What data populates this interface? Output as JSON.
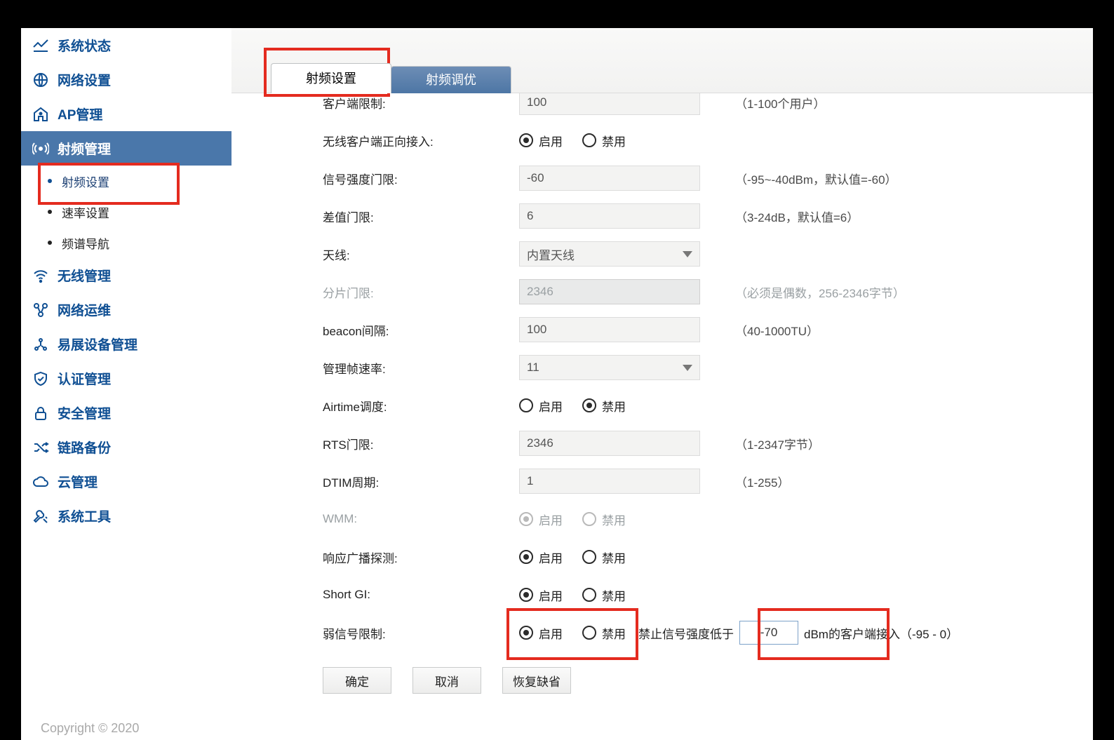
{
  "sidebar": {
    "items": [
      {
        "id": "system-status",
        "label": "系统状态"
      },
      {
        "id": "network-settings",
        "label": "网络设置"
      },
      {
        "id": "ap-management",
        "label": "AP管理"
      },
      {
        "id": "rf-management",
        "label": "射频管理"
      },
      {
        "id": "wireless-management",
        "label": "无线管理"
      },
      {
        "id": "network-ops",
        "label": "网络运维"
      },
      {
        "id": "yizhan-device",
        "label": "易展设备管理"
      },
      {
        "id": "auth-management",
        "label": "认证管理"
      },
      {
        "id": "security-management",
        "label": "安全管理"
      },
      {
        "id": "link-backup",
        "label": "链路备份"
      },
      {
        "id": "cloud-management",
        "label": "云管理"
      },
      {
        "id": "system-tools",
        "label": "系统工具"
      }
    ],
    "sub_items": [
      {
        "id": "rf-settings",
        "label": "射频设置"
      },
      {
        "id": "rate-settings",
        "label": "速率设置"
      },
      {
        "id": "spectrum-nav",
        "label": "频谱导航"
      }
    ],
    "active": "rf-management",
    "current_sub": "rf-settings"
  },
  "footer": {
    "copyright": "Copyright © 2020"
  },
  "tabs": {
    "items": [
      {
        "id": "rf-settings-tab",
        "label": "射频设置"
      },
      {
        "id": "rf-tuning-tab",
        "label": "射频调优"
      }
    ],
    "active": "rf-settings-tab"
  },
  "options": {
    "enable": "启用",
    "disable": "禁用"
  },
  "form": {
    "client_limit": {
      "label": "客户端限制:",
      "value": "100",
      "hint": "（1-100个用户）"
    },
    "positive_access": {
      "label": "无线客户端正向接入:",
      "value": "enable"
    },
    "signal_threshold": {
      "label": "信号强度门限:",
      "value": "-60",
      "hint": "（-95~-40dBm，默认值=-60）"
    },
    "diff_threshold": {
      "label": "差值门限:",
      "value": "6",
      "hint": "（3-24dB，默认值=6）"
    },
    "antenna": {
      "label": "天线:",
      "value": "内置天线"
    },
    "fragment": {
      "label": "分片门限:",
      "value": "2346",
      "hint": "（必须是偶数，256-2346字节）"
    },
    "beacon": {
      "label": "beacon间隔:",
      "value": "100",
      "hint": "（40-1000TU）"
    },
    "mgmt_rate": {
      "label": "管理帧速率:",
      "value": "11"
    },
    "airtime": {
      "label": "Airtime调度:",
      "value": "disable"
    },
    "rts": {
      "label": "RTS门限:",
      "value": "2346",
      "hint": "（1-2347字节）"
    },
    "dtim": {
      "label": "DTIM周期:",
      "value": "1",
      "hint": "（1-255）"
    },
    "wmm": {
      "label": "WMM:",
      "value": "enable"
    },
    "broadcast_probe": {
      "label": "响应广播探测:",
      "value": "enable"
    },
    "short_gi": {
      "label": "Short GI:",
      "value": "enable"
    },
    "weak_signal": {
      "label": "弱信号限制:",
      "value": "enable",
      "inline_prefix": "禁止信号强度低于",
      "inline_value": "-70",
      "inline_mid": "dBm的客户端接入",
      "inline_suffix": "（-95 - 0）"
    }
  },
  "buttons": {
    "ok": "确定",
    "cancel": "取消",
    "restore": "恢复缺省"
  }
}
